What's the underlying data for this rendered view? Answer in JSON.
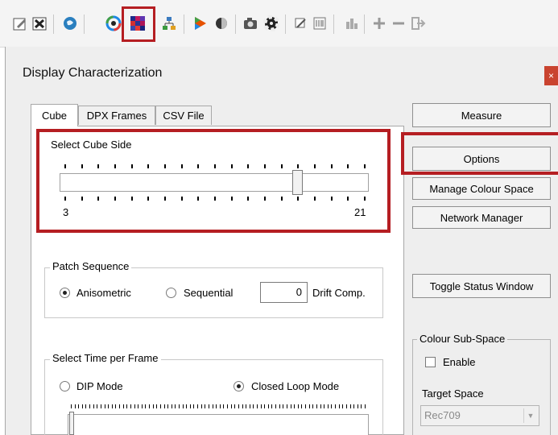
{
  "toolbar": {
    "icons": [
      "edit-icon",
      "delete-icon",
      "globe-icon",
      "color-wheel-icon",
      "color-patches-icon",
      "network-icon",
      "color-triangle-icon",
      "sphere-icon",
      "camera-icon",
      "radiation-icon",
      "wand-icon",
      "abc-icon",
      "chart-icon",
      "plus-icon",
      "minus-icon",
      "exit-icon"
    ]
  },
  "dialog": {
    "title": "Display Characterization",
    "close_glyph": "×"
  },
  "tabs": [
    "Cube",
    "DPX Frames",
    "CSV File"
  ],
  "cube": {
    "label": "Select Cube Side",
    "min_label": "3",
    "max_label": "21",
    "min": 3,
    "max": 21,
    "value": 17
  },
  "patch_sequence": {
    "title": "Patch Sequence",
    "option_anisometric": "Anisometric",
    "option_sequential": "Sequential",
    "selected": "Anisometric",
    "drift_value": "0",
    "drift_label": "Drift Comp."
  },
  "time_per_frame": {
    "title": "Select Time per Frame",
    "option_dip": "DIP Mode",
    "option_closed": "Closed Loop Mode",
    "selected": "Closed Loop Mode"
  },
  "buttons": {
    "measure": "Measure",
    "options": "Options",
    "manage_colour_space": "Manage Colour Space",
    "network_manager": "Network Manager",
    "toggle_status_window": "Toggle Status Window"
  },
  "colour_subspace": {
    "title": "Colour Sub-Space",
    "enable_label": "Enable",
    "enabled": false,
    "target_label": "Target Space",
    "target_value": "Rec709"
  },
  "colors": {
    "highlight": "#b51e22",
    "close_button": "#c9432f"
  }
}
